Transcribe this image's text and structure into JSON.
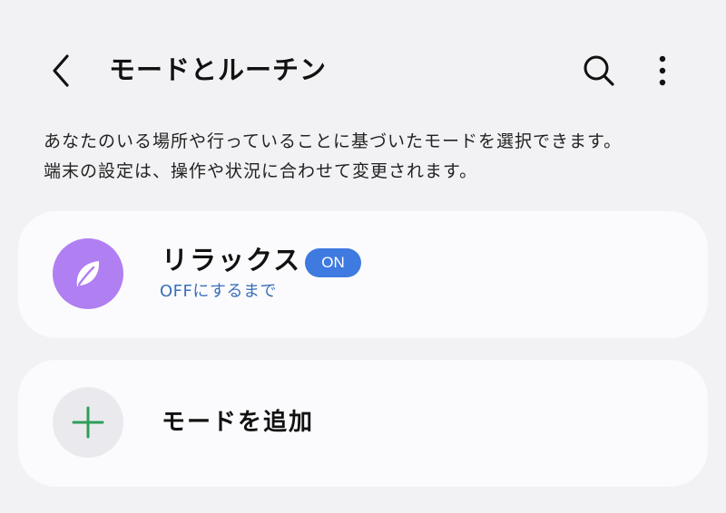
{
  "header": {
    "title": "モードとルーチン",
    "back_icon": "chevron-left-icon",
    "search_icon": "search-icon",
    "more_icon": "more-vertical-icon"
  },
  "description": {
    "line1": "あなたのいる場所や行っていることに基づいたモードを選択できます。",
    "line2": "端末の設定は、操作や状況に合わせて変更されます。"
  },
  "modes": [
    {
      "name": "リラックス",
      "status_badge": "ON",
      "subtitle": "OFFにするまで",
      "icon": "leaf-icon",
      "icon_color": "#b07ff2",
      "badge_color": "#3e7ae0"
    }
  ],
  "add_mode": {
    "label": "モードを追加",
    "icon": "plus-icon",
    "icon_color": "#2f9e5a"
  },
  "colors": {
    "background": "#f2f2f4",
    "card": "#fbfbfd",
    "subtitle_text": "#3a6fb8"
  }
}
